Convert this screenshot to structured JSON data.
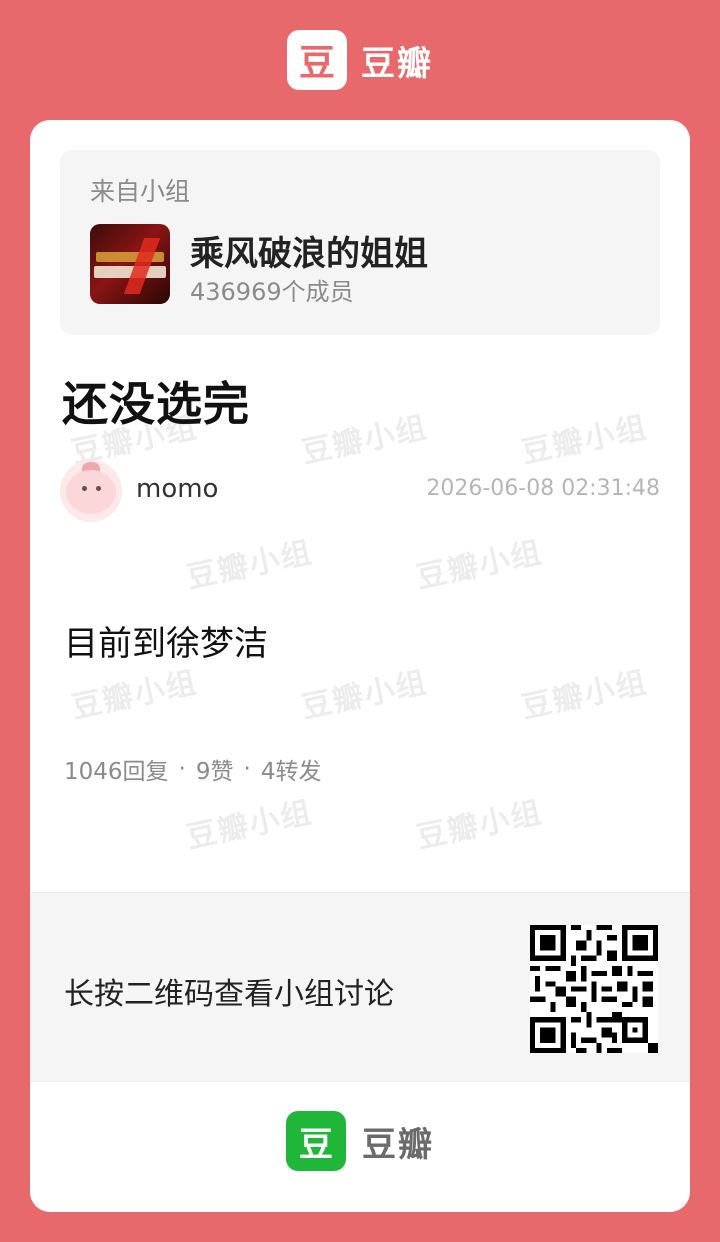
{
  "header": {
    "logo_glyph": "豆",
    "brand": "豆瓣"
  },
  "group": {
    "from_label": "来自小组",
    "cover_alt": "乘风破浪的姐姐",
    "name": "乘风破浪的姐姐",
    "members": "436969个成员"
  },
  "post": {
    "title": "还没选完",
    "author": "momo",
    "timestamp": "2026-06-08 02:31:48",
    "body": "目前到徐梦洁",
    "stats": {
      "replies": "1046回复",
      "likes": "9赞",
      "reposts": "4转发",
      "separator": "·"
    }
  },
  "watermark": {
    "text": "豆瓣小组"
  },
  "qr": {
    "hint": "长按二维码查看小组讨论"
  },
  "footer": {
    "logo_glyph": "豆",
    "brand": "豆瓣"
  },
  "colors": {
    "background": "#e8696b",
    "brand_green": "#20b639"
  }
}
